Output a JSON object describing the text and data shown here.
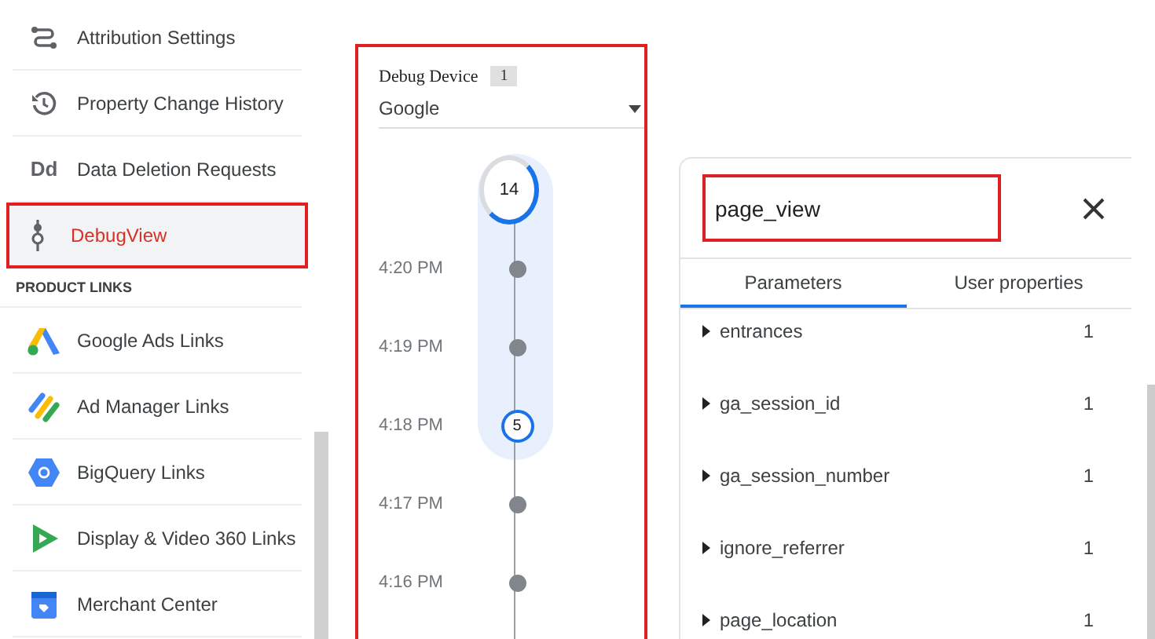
{
  "sidebar": {
    "items": [
      {
        "label": "Attribution Settings",
        "selected": false
      },
      {
        "label": "Property Change History",
        "selected": false
      },
      {
        "label": "Data Deletion Requests",
        "selected": false,
        "icon_text": "Dd"
      },
      {
        "label": "DebugView",
        "selected": true
      }
    ],
    "section": {
      "title": "PRODUCT LINKS",
      "items": [
        {
          "label": "Google Ads Links"
        },
        {
          "label": "Ad Manager Links"
        },
        {
          "label": "BigQuery Links"
        },
        {
          "label": "Display & Video 360 Links"
        },
        {
          "label": "Merchant Center"
        }
      ]
    }
  },
  "debug_device": {
    "title": "Debug Device",
    "count": "1",
    "value": "Google"
  },
  "timeline": [
    {
      "kind": "ring",
      "count": "14"
    },
    {
      "kind": "dot",
      "time": "4:20 PM"
    },
    {
      "kind": "dot",
      "time": "4:19 PM"
    },
    {
      "kind": "count",
      "time": "4:18 PM",
      "count": "5"
    },
    {
      "kind": "dot",
      "time": "4:17 PM"
    },
    {
      "kind": "dot",
      "time": "4:16 PM"
    }
  ],
  "event_panel": {
    "event_name": "page_view",
    "tabs": [
      {
        "label": "Parameters",
        "selected": true
      },
      {
        "label": "User properties",
        "selected": false
      }
    ],
    "parameters": [
      {
        "name": "entrances",
        "value": "1"
      },
      {
        "name": "ga_session_id",
        "value": "1"
      },
      {
        "name": "ga_session_number",
        "value": "1"
      },
      {
        "name": "ignore_referrer",
        "value": "1"
      },
      {
        "name": "page_location",
        "value": "1"
      }
    ]
  }
}
